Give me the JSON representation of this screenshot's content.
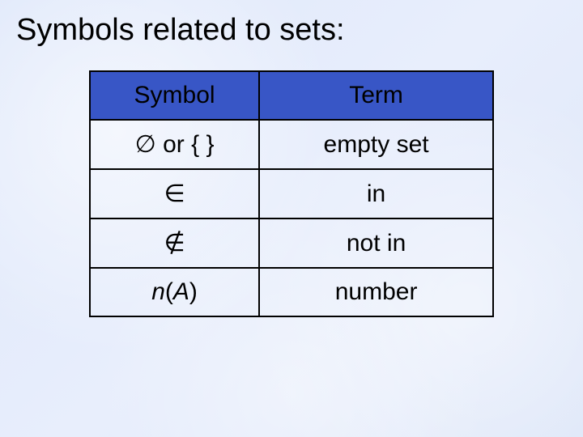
{
  "title": "Symbols related to sets:",
  "headers": {
    "symbol": "Symbol",
    "term": "Term"
  },
  "rows": [
    {
      "symbol": "∅ or { }",
      "term": "empty set"
    },
    {
      "symbol": "∈",
      "term": "in"
    },
    {
      "symbol": "∉",
      "term": "not in"
    },
    {
      "symbol_html": "<span class=\"italic\">n</span>(<span class=\"italic\">A</span>)",
      "term": "number"
    }
  ],
  "chart_data": {
    "type": "table",
    "title": "Symbols related to sets:",
    "columns": [
      "Symbol",
      "Term"
    ],
    "rows": [
      [
        "∅ or { }",
        "empty set"
      ],
      [
        "∈",
        "in"
      ],
      [
        "∉",
        "not in"
      ],
      [
        "n(A)",
        "number"
      ]
    ]
  }
}
